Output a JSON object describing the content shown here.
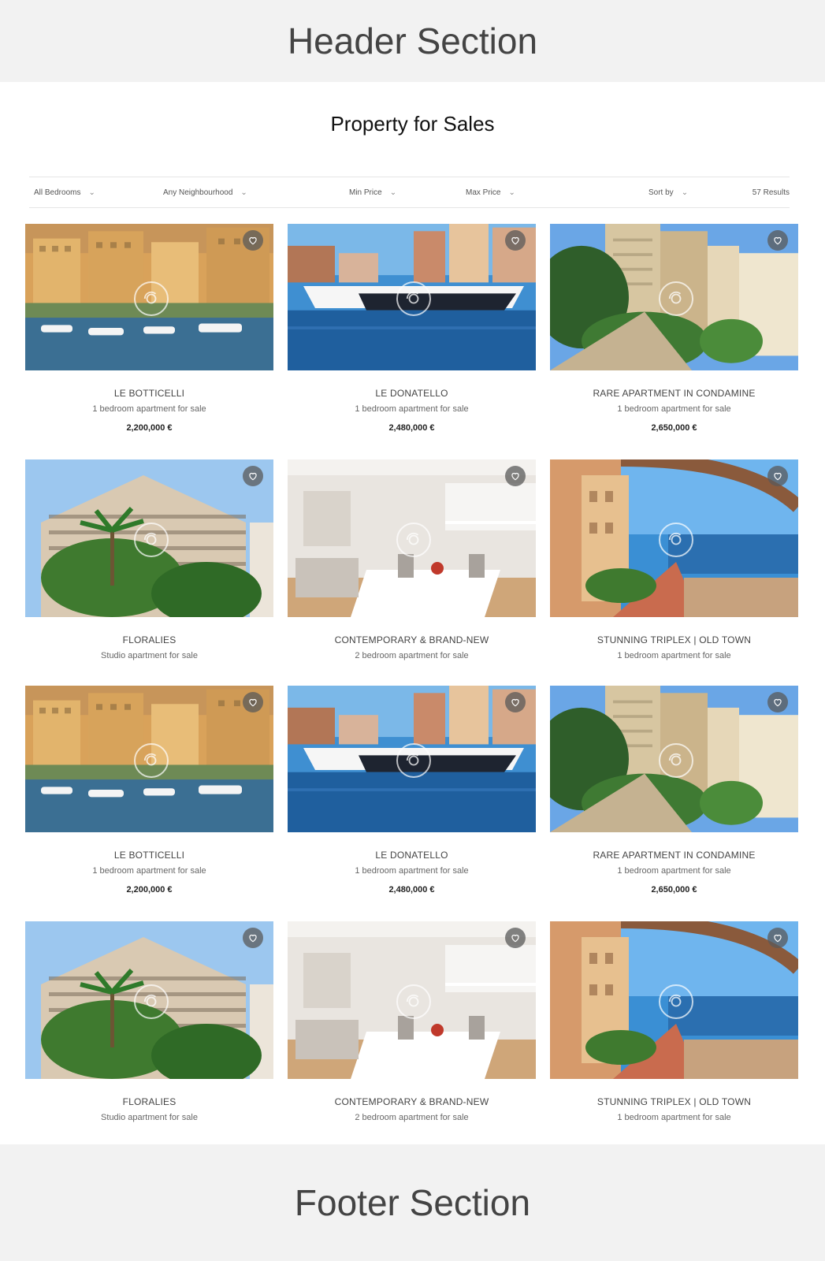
{
  "header": {
    "title": "Header Section"
  },
  "footer": {
    "title": "Footer Section"
  },
  "page": {
    "title": "Property for Sales"
  },
  "filters": {
    "bedrooms": "All Bedrooms",
    "neighbourhood": "Any Neighbourhood",
    "min_price": "Min Price",
    "max_price": "Max Price",
    "sort": "Sort by",
    "results": "57 Results"
  },
  "listings": [
    {
      "name": "LE BOTTICELLI",
      "desc": "1 bedroom apartment for sale",
      "price": "2,200,000 €",
      "scene": "harbor-buildings"
    },
    {
      "name": "LE DONATELLO",
      "desc": "1 bedroom apartment for sale",
      "price": "2,480,000 €",
      "scene": "yachts"
    },
    {
      "name": "RARE APARTMENT IN CONDAMINE",
      "desc": "1 bedroom apartment for sale",
      "price": "2,650,000 €",
      "scene": "garden-towers"
    },
    {
      "name": "FLORALIES",
      "desc": "Studio apartment for sale",
      "price": "",
      "scene": "palm-building"
    },
    {
      "name": "CONTEMPORARY & BRAND-NEW",
      "desc": "2 bedroom apartment for sale",
      "price": "",
      "scene": "interior"
    },
    {
      "name": "STUNNING TRIPLEX | OLD TOWN",
      "desc": "1 bedroom apartment for sale",
      "price": "",
      "scene": "old-town-sea"
    },
    {
      "name": "LE BOTTICELLI",
      "desc": "1 bedroom apartment for sale",
      "price": "2,200,000 €",
      "scene": "harbor-buildings"
    },
    {
      "name": "LE DONATELLO",
      "desc": "1 bedroom apartment for sale",
      "price": "2,480,000 €",
      "scene": "yachts"
    },
    {
      "name": "RARE APARTMENT IN CONDAMINE",
      "desc": "1 bedroom apartment for sale",
      "price": "2,650,000 €",
      "scene": "garden-towers"
    },
    {
      "name": "FLORALIES",
      "desc": "Studio apartment for sale",
      "price": "",
      "scene": "palm-building"
    },
    {
      "name": "CONTEMPORARY & BRAND-NEW",
      "desc": "2 bedroom apartment for sale",
      "price": "",
      "scene": "interior"
    },
    {
      "name": "STUNNING TRIPLEX | OLD TOWN",
      "desc": "1 bedroom apartment for sale",
      "price": "",
      "scene": "old-town-sea"
    }
  ],
  "icons": {
    "favorite": "heart-icon",
    "view": "view-360-icon",
    "dropdown": "chevron-down-icon"
  }
}
